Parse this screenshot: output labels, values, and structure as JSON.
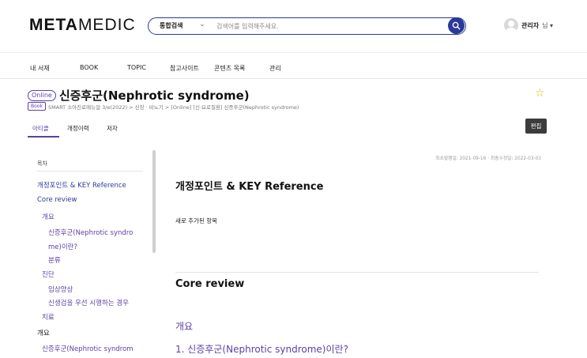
{
  "header": {
    "logo_bold": "META",
    "logo_light": "MEDIC",
    "search": {
      "scope": "통합검색",
      "placeholder": "검색어를 입력해주세요."
    },
    "user": {
      "name": "관리자",
      "suffix": "님 ▾"
    }
  },
  "nav": {
    "items": [
      "내 서재",
      "BOOK",
      "TOPIC",
      "참고사이트",
      "콘텐츠 목록",
      "관리"
    ]
  },
  "article": {
    "badge": "Online",
    "title": "신증후군(Nephrotic syndrome)",
    "book_badge": "Book",
    "breadcrumb": "SMART 소아진료매뉴얼 3/e(2022) > 신장 · 비뇨기 > [Online] [신·요로질환] 신증후군(Nephrotic syndrome)"
  },
  "tabs": {
    "items": [
      "아티클",
      "개정이력",
      "저자"
    ],
    "edit_label": "편집"
  },
  "toc": {
    "title": "목차",
    "items": [
      "개정포인트 & KEY Reference",
      "Core review",
      "개요",
      "신증후군(Nephrotic syndro",
      "me)이란?",
      "분류",
      "진단",
      "임상양상",
      "신생검을 우선 시행하는 경우",
      "치료",
      "개요",
      "신증후군(Nephrotic syndrom"
    ]
  },
  "content": {
    "dates": "최초발행일: 2021-09-16 · 최종수정일: 2022-03-03",
    "section1_title": "개정포인트 & KEY Reference",
    "section1_text": "새로 추가된 항목",
    "section2_title": "Core review",
    "sub_title": "개요",
    "item_title": "1. 신증후군(Nephrotic syndrome)이란?"
  },
  "colors": {
    "brand_navy": "#2b3a9a",
    "accent_purple": "#5b3fa8",
    "star": "#e6b400"
  }
}
